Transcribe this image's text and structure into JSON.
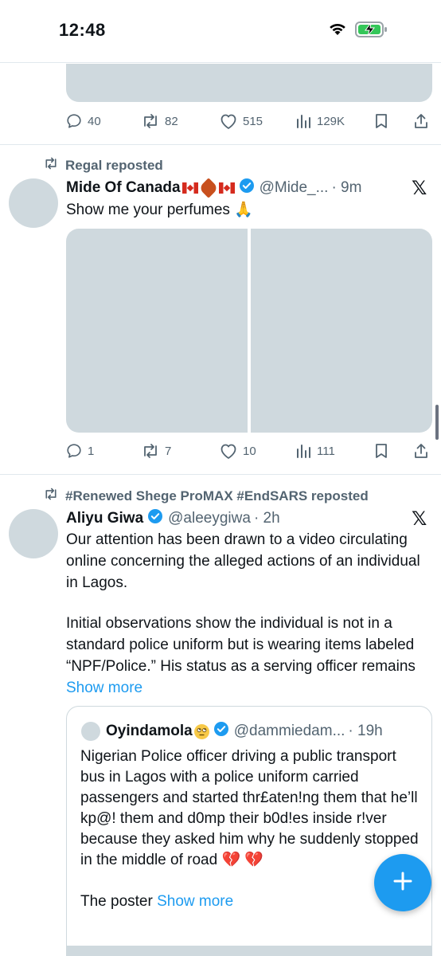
{
  "status_bar": {
    "time": "12:48",
    "battery_charging": true
  },
  "tweets": [
    {
      "stats": {
        "replies": "40",
        "reposts": "82",
        "likes": "515",
        "views": "129K"
      }
    },
    {
      "reposted_by": "Regal reposted",
      "name": "Mide Of Canada",
      "handle": "@Mide_...",
      "time": "· 9m",
      "text": "Show me your perfumes 🙏",
      "stats": {
        "replies": "1",
        "reposts": "7",
        "likes": "10",
        "views": "111"
      }
    },
    {
      "reposted_by": "#Renewed Shege ProMAX #EndSARS reposted",
      "name": "Aliyu Giwa",
      "handle": "@aleeygiwa",
      "time": "· 2h",
      "text_p1": "Our attention has been drawn to a video circulating online concerning the alleged actions of an individual in Lagos.",
      "text_p2": "Initial observations show the individual is not in a standard police uniform but is wearing items labeled “NPF/Police.” His status as a serving officer remains",
      "show_more": "Show more",
      "quote": {
        "name": "Oyindamola",
        "handle": "@dammiedam...",
        "time": "· 19h",
        "text": "Nigerian Police officer driving a public transport bus in Lagos with a police uniform carried passengers and started thr£aten!ng them that he’ll kp@! them and d0mp their b0d!es inside r!ver because they asked him why he suddenly stopped in the middle of road",
        "emoji": "💔 💔",
        "text2": "The poster",
        "show_more": "Show more"
      }
    }
  ],
  "x_logo": "𝕏",
  "colors": {
    "accent": "#1d9bf0",
    "muted": "#536471",
    "media": "#cfd9de"
  }
}
